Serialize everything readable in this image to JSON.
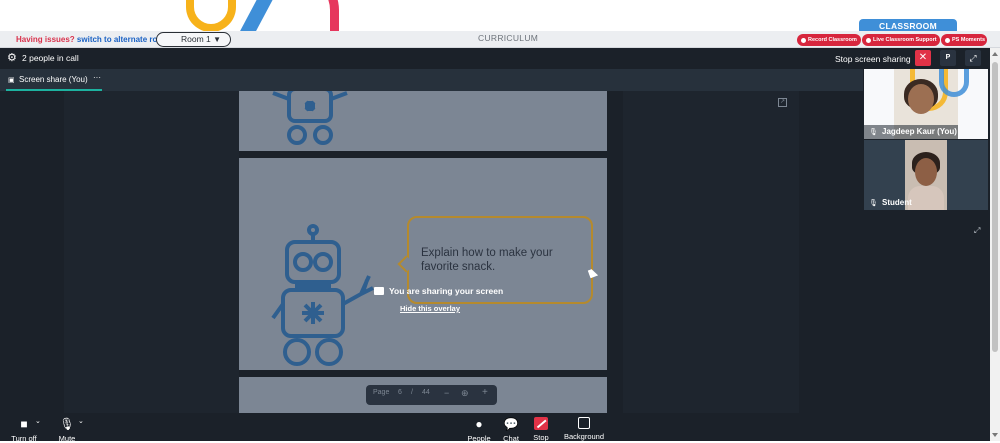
{
  "banner": {
    "issues_text": "Having issues?",
    "switch_link": "switch to alternate room",
    "room_select": "Room 1",
    "curriculum_tab": "CURRICULUM",
    "classroom_tab": "CLASSROOM",
    "pills": [
      "Record Classroom",
      "Live Classroom Support",
      "PS Moments"
    ]
  },
  "call": {
    "participants_count": "2 people in call",
    "stop_sharing": "Stop screen sharing",
    "close_icon": "✕",
    "p_button": "P",
    "fullscreen_icon": "⤢"
  },
  "tab": {
    "label": "Screen share (You)",
    "more": "···"
  },
  "slide": {
    "prompt": "Explain how to make your favorite snack."
  },
  "overlay": {
    "message": "You are sharing your screen",
    "hide": "Hide this overlay"
  },
  "pager": {
    "label": "Page",
    "current": "6",
    "separator": "/",
    "total": "44",
    "zoom_out": "−",
    "zoom_icon": "⊕",
    "zoom_in": "+"
  },
  "participants": [
    {
      "name": "Jagdeep Kaur (You)"
    },
    {
      "name": "Student"
    }
  ],
  "controls": {
    "turn_off": "Turn off",
    "mute": "Mute",
    "people": "People",
    "chat": "Chat",
    "stop": "Stop",
    "background": "Background"
  },
  "colors": {
    "accent_red": "#d7263d",
    "accent_blue": "#3f8fd8",
    "tab_underline": "#1db2a0",
    "app_bg": "#1b2129"
  },
  "icons": [
    "gear-icon",
    "monitor-icon",
    "close-icon",
    "fullscreen-icon",
    "external-link-icon",
    "mic-icon",
    "camera-icon",
    "person-icon",
    "chat-icon",
    "stop-share-icon",
    "background-icon"
  ]
}
